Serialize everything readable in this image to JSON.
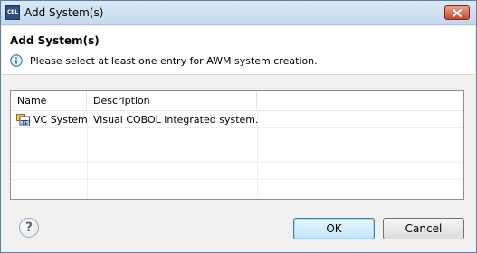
{
  "window": {
    "title": "Add System(s)",
    "app_icon_text": "CBL"
  },
  "header": {
    "title": "Add System(s)",
    "info_message": "Please select at least one entry for AWM system creation."
  },
  "table": {
    "columns": [
      "Name",
      "Description"
    ],
    "rows": [
      {
        "name": "VC System",
        "description": "Visual COBOL integrated system.",
        "icon": "system-icon"
      }
    ]
  },
  "footer": {
    "help_label": "?",
    "ok_label": "OK",
    "cancel_label": "Cancel"
  },
  "colors": {
    "titlebar": "#c3d8ee",
    "close_button": "#c6492c",
    "default_button": "#bee6fd",
    "info_icon": "#2a6fb4"
  }
}
